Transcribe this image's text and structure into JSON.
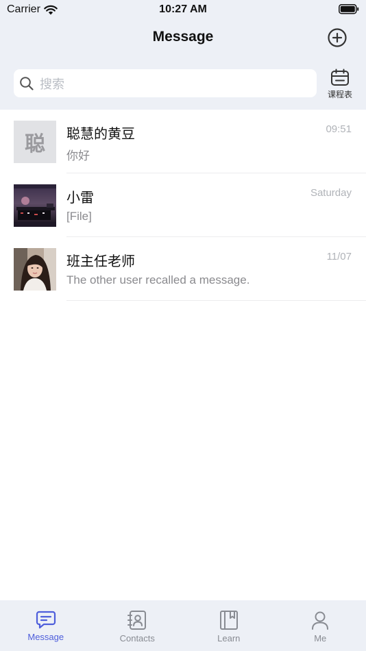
{
  "status_bar": {
    "carrier": "Carrier",
    "time": "10:27 AM"
  },
  "nav": {
    "title": "Message",
    "add_icon": "plus-circle-icon"
  },
  "search": {
    "placeholder": "搜索",
    "icon": "search-icon"
  },
  "schedule": {
    "label": "课程表",
    "icon": "calendar-icon"
  },
  "conversations": [
    {
      "name": "聪慧的黄豆",
      "avatar_text": "聪",
      "preview": "你好",
      "time": "09:51"
    },
    {
      "name": "小雷",
      "preview": "[File]",
      "time": "Saturday"
    },
    {
      "name": "班主任老师",
      "preview": "The other user recalled a message.",
      "time": "11/07"
    }
  ],
  "tabs": [
    {
      "label": "Message",
      "icon": "message-icon",
      "active": true
    },
    {
      "label": "Contacts",
      "icon": "contacts-icon",
      "active": false
    },
    {
      "label": "Learn",
      "icon": "book-icon",
      "active": false
    },
    {
      "label": "Me",
      "icon": "person-icon",
      "active": false
    }
  ],
  "colors": {
    "header_bg": "#EDF0F6",
    "accent": "#4D5DDB",
    "inactive_tab": "#888B92",
    "muted_text": "#8A8A8E"
  }
}
